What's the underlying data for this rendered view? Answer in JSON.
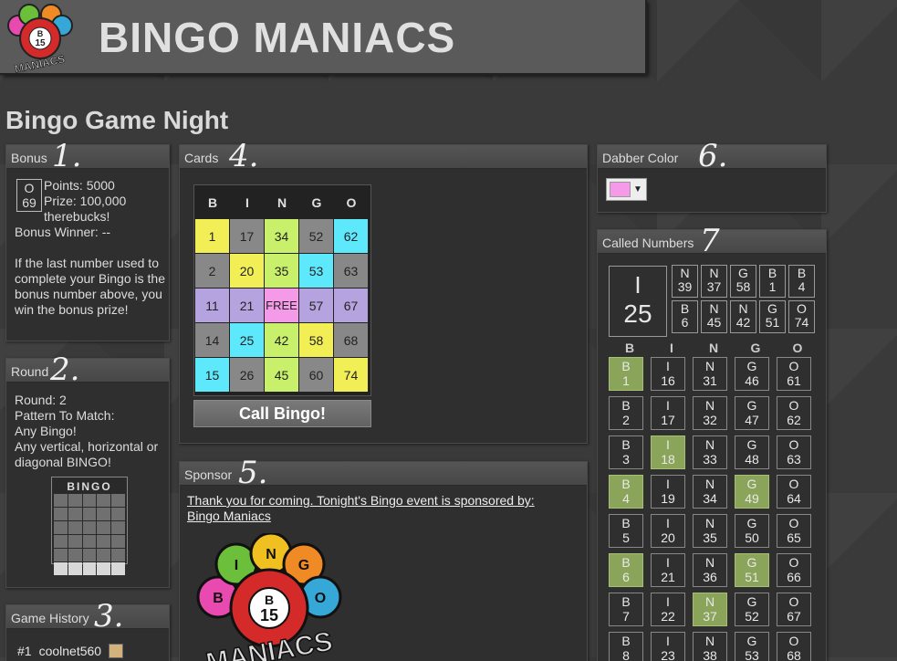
{
  "header": {
    "title": "BINGO MANIACS",
    "logo": {
      "letters": [
        "B",
        "I",
        "N",
        "G",
        "O"
      ],
      "center_ball": "B",
      "center_num": "15",
      "wordmark": "MANIACS"
    }
  },
  "page_title": "Bingo Game Night",
  "steps": {
    "bonus": "1.",
    "round": "2.",
    "history": "3.",
    "cards": "4.",
    "sponsor": "5.",
    "dabber": "6.",
    "called": "7"
  },
  "bonus": {
    "title": "Bonus",
    "ball_letter": "O",
    "ball_number": "69",
    "points": "Points: 5000",
    "prize_line1": "Prize: 100,000",
    "prize_line2": "therebucks!",
    "winner": "Bonus Winner: --",
    "text": "If the last number used to complete your Bingo is the bonus number above, you win the bonus prize!"
  },
  "round": {
    "title": "Round",
    "round_line": "Round: 2",
    "pattern_label": "Pattern To Match:",
    "pattern_name": "Any Bingo!",
    "pattern_desc": "Any vertical, horizontal or diagonal BINGO!",
    "mini_letters": "BINGO",
    "mini_pattern": [
      0,
      0,
      0,
      0,
      0,
      0,
      0,
      0,
      0,
      0,
      0,
      0,
      0,
      0,
      0,
      0,
      0,
      0,
      0,
      0,
      0,
      0,
      0,
      0,
      0,
      1,
      1,
      1,
      1,
      1
    ]
  },
  "history": {
    "title": "Game History",
    "rows": [
      {
        "rank": "#1",
        "name": "coolnet560",
        "color": "#d4b27e"
      }
    ]
  },
  "cards": {
    "title": "Cards",
    "headers": [
      "B",
      "I",
      "N",
      "G",
      "O"
    ],
    "cells": [
      {
        "v": "1",
        "c": "#f2ee55"
      },
      {
        "v": "17",
        "c": "#888888"
      },
      {
        "v": "34",
        "c": "#c9f06a"
      },
      {
        "v": "52",
        "c": "#888888"
      },
      {
        "v": "62",
        "c": "#5ee8fc"
      },
      {
        "v": "2",
        "c": "#888888"
      },
      {
        "v": "20",
        "c": "#f2ee55"
      },
      {
        "v": "35",
        "c": "#c9f06a"
      },
      {
        "v": "53",
        "c": "#5ee8fc"
      },
      {
        "v": "63",
        "c": "#888888"
      },
      {
        "v": "11",
        "c": "#b5a3e0"
      },
      {
        "v": "21",
        "c": "#b5a3e0"
      },
      {
        "v": "FREE",
        "c": "#f49ae8"
      },
      {
        "v": "57",
        "c": "#b5a3e0"
      },
      {
        "v": "67",
        "c": "#b5a3e0"
      },
      {
        "v": "14",
        "c": "#888888"
      },
      {
        "v": "25",
        "c": "#5ee8fc"
      },
      {
        "v": "42",
        "c": "#c9f06a"
      },
      {
        "v": "58",
        "c": "#f2ee55"
      },
      {
        "v": "68",
        "c": "#888888"
      },
      {
        "v": "15",
        "c": "#5ee8fc"
      },
      {
        "v": "26",
        "c": "#888888"
      },
      {
        "v": "45",
        "c": "#c9f06a"
      },
      {
        "v": "60",
        "c": "#888888"
      },
      {
        "v": "74",
        "c": "#f2ee55"
      }
    ],
    "call_button": "Call Bingo!"
  },
  "sponsor": {
    "title": "Sponsor",
    "link_line1": "Thank you for coming. Tonight's Bingo event is sponsored by:",
    "link_line2": "Bingo Maniacs"
  },
  "dabber": {
    "title": "Dabber Color",
    "selected_color": "#f49ae8",
    "arrow": "▼"
  },
  "called": {
    "title": "Called Numbers",
    "last": {
      "letter": "I",
      "number": "25"
    },
    "recent": [
      {
        "l": "N",
        "n": "39"
      },
      {
        "l": "N",
        "n": "37"
      },
      {
        "l": "G",
        "n": "58"
      },
      {
        "l": "B",
        "n": "1"
      },
      {
        "l": "B",
        "n": "4"
      },
      {
        "l": "B",
        "n": "6"
      },
      {
        "l": "N",
        "n": "45"
      },
      {
        "l": "N",
        "n": "42"
      },
      {
        "l": "G",
        "n": "51"
      },
      {
        "l": "O",
        "n": "74"
      }
    ],
    "headers": [
      "B",
      "I",
      "N",
      "G",
      "O"
    ],
    "board": [
      [
        {
          "l": "B",
          "n": "1",
          "h": 1
        },
        {
          "l": "I",
          "n": "16",
          "h": 0
        },
        {
          "l": "N",
          "n": "31",
          "h": 0
        },
        {
          "l": "G",
          "n": "46",
          "h": 0
        },
        {
          "l": "O",
          "n": "61",
          "h": 0
        }
      ],
      [
        {
          "l": "B",
          "n": "2",
          "h": 0
        },
        {
          "l": "I",
          "n": "17",
          "h": 0
        },
        {
          "l": "N",
          "n": "32",
          "h": 0
        },
        {
          "l": "G",
          "n": "47",
          "h": 0
        },
        {
          "l": "O",
          "n": "62",
          "h": 0
        }
      ],
      [
        {
          "l": "B",
          "n": "3",
          "h": 0
        },
        {
          "l": "I",
          "n": "18",
          "h": 1
        },
        {
          "l": "N",
          "n": "33",
          "h": 0
        },
        {
          "l": "G",
          "n": "48",
          "h": 0
        },
        {
          "l": "O",
          "n": "63",
          "h": 0
        }
      ],
      [
        {
          "l": "B",
          "n": "4",
          "h": 1
        },
        {
          "l": "I",
          "n": "19",
          "h": 0
        },
        {
          "l": "N",
          "n": "34",
          "h": 0
        },
        {
          "l": "G",
          "n": "49",
          "h": 1
        },
        {
          "l": "O",
          "n": "64",
          "h": 0
        }
      ],
      [
        {
          "l": "B",
          "n": "5",
          "h": 0
        },
        {
          "l": "I",
          "n": "20",
          "h": 0
        },
        {
          "l": "N",
          "n": "35",
          "h": 0
        },
        {
          "l": "G",
          "n": "50",
          "h": 0
        },
        {
          "l": "O",
          "n": "65",
          "h": 0
        }
      ],
      [
        {
          "l": "B",
          "n": "6",
          "h": 1
        },
        {
          "l": "I",
          "n": "21",
          "h": 0
        },
        {
          "l": "N",
          "n": "36",
          "h": 0
        },
        {
          "l": "G",
          "n": "51",
          "h": 1
        },
        {
          "l": "O",
          "n": "66",
          "h": 0
        }
      ],
      [
        {
          "l": "B",
          "n": "7",
          "h": 0
        },
        {
          "l": "I",
          "n": "22",
          "h": 0
        },
        {
          "l": "N",
          "n": "37",
          "h": 1
        },
        {
          "l": "G",
          "n": "52",
          "h": 0
        },
        {
          "l": "O",
          "n": "67",
          "h": 0
        }
      ],
      [
        {
          "l": "B",
          "n": "8",
          "h": 0
        },
        {
          "l": "I",
          "n": "23",
          "h": 0
        },
        {
          "l": "N",
          "n": "38",
          "h": 0
        },
        {
          "l": "G",
          "n": "53",
          "h": 0
        },
        {
          "l": "O",
          "n": "68",
          "h": 0
        }
      ]
    ]
  }
}
